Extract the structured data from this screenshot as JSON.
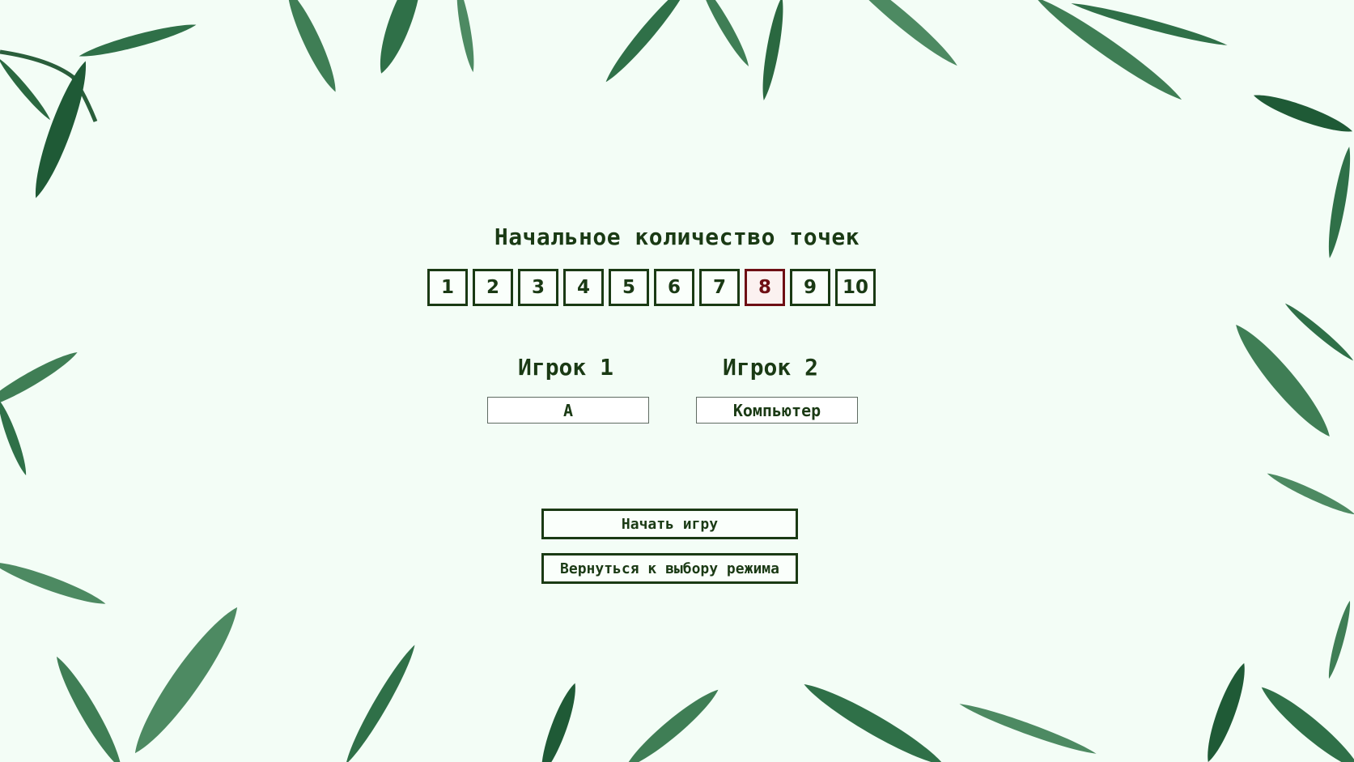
{
  "points_selector": {
    "title": "Начальное количество точек",
    "options": [
      "1",
      "2",
      "3",
      "4",
      "5",
      "6",
      "7",
      "8",
      "9",
      "10"
    ],
    "selected": "8"
  },
  "players": [
    {
      "label": "Игрок 1",
      "value": "А"
    },
    {
      "label": "Игрок 2",
      "value": "Компьютер"
    }
  ],
  "actions": {
    "start_label": "Начать игру",
    "back_label": "Вернуться к выбору режима"
  },
  "colors": {
    "background": "#f3fdf6",
    "primary": "#1a3a14",
    "selected": "#6e0f14",
    "leaf_dark": "#1f5a36",
    "leaf_mid": "#2f7048",
    "leaf_light": "#4d8a62"
  },
  "icons": {
    "decoration": "watercolor-leaves"
  }
}
